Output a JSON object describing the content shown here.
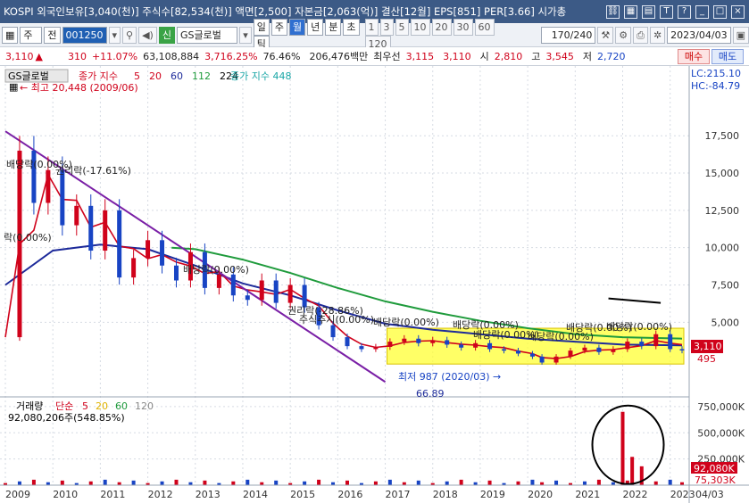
{
  "titlebar": {
    "text": "KOSPI 외국인보유[3,040(천)] 주식수[82,534(천)] 액면[2,500] 자본금[2,063(억)] 결산[12월] EPS[851] PER[3.66] 시가총",
    "icons": [
      "link-icon",
      "grid-icon",
      "tile-icon",
      "text-icon",
      "help-icon",
      "minimize-icon",
      "maximize-icon",
      "close-icon"
    ]
  },
  "toolbar": {
    "type_select": "주",
    "prev_label": "전",
    "code_value": "001250",
    "sound_icon": "speaker-icon",
    "credit_badge": "신",
    "name_value": "GS글로벌",
    "periods": [
      "일",
      "주",
      "월",
      "년",
      "분",
      "초",
      "틱"
    ],
    "selected_period": "월",
    "intervals": [
      "1",
      "3",
      "5",
      "10",
      "20",
      "30",
      "60",
      "120"
    ],
    "count_value": "170/240",
    "date_value": "2023/04/03"
  },
  "quote": {
    "price": "3,110",
    "change": "310",
    "change_pct": "+11.07%",
    "volume": "63,108,884",
    "volume_ratio": "3,716.25%",
    "turnover": "76.46%",
    "amount": "206,476백만",
    "best_label": "최우선",
    "ask": "3,115",
    "bid": "3,110",
    "open_label": "시",
    "open": "2,810",
    "high_label": "고",
    "high": "3,545",
    "low_label": "저",
    "low": "2,720",
    "buy_label": "매수",
    "sell_label": "매도"
  },
  "price_panel": {
    "stock_name": "GS글로벌",
    "ma_label": "종가 지수",
    "ma_periods": [
      "5",
      "20",
      "60",
      "112",
      "224"
    ],
    "ma_colors": [
      "#d0021b",
      "#d0021b",
      "#1d2a9a",
      "#1f9b3c",
      "#000000"
    ],
    "ma448_label": "종가 지수 448",
    "ma448_color": "#19a6a6",
    "lc": "LC:215.10",
    "hc": "HC:-84.79",
    "max_label": "최고 20,448 (2009/06)",
    "min_label": "최저 987 (2020/03)",
    "line_end_label": "66.89",
    "current_price_tag": "3,110",
    "sub_tag": "495",
    "annotations": [
      "배당락(0.00%)",
      "권리락(-17.61%)",
      "락(0.00%)",
      "배당락(0.00%)",
      "권리락(-28.86%)",
      "주식추시(0.00%)",
      "배당락(0.00%)",
      "배당락(0.00%)",
      "배당락(0.00%)",
      "배당락(0.00%)",
      "배당락(0.00%)",
      "배당락(0.00%)"
    ]
  },
  "volume_panel": {
    "label": "거래량",
    "ma_label": "단순",
    "ma_periods": [
      "5",
      "20",
      "60",
      "120"
    ],
    "ma_colors": [
      "#d0021b",
      "#e0b300",
      "#1f9b3c",
      "#888888"
    ],
    "value_text": "92,080,206주(548.85%)",
    "tag_current": "92,080K",
    "tag_sub": "75,303K"
  },
  "xaxis": {
    "years": [
      "2009",
      "2010",
      "2011",
      "2012",
      "2013",
      "2014",
      "2015",
      "2016",
      "2017",
      "2018",
      "2019",
      "2020",
      "2021",
      "2022",
      "2023"
    ],
    "end_label": "04/03"
  },
  "chart_data": {
    "type": "candlestick",
    "title": "",
    "xlabel": "",
    "ylabel": "",
    "price_axis": {
      "ticks": [
        "17,500",
        "15,000",
        "12,500",
        "10,000",
        "7,500",
        "5,000"
      ],
      "tick_values": [
        17500,
        15000,
        12500,
        10000,
        7500,
        5000
      ],
      "ylim": [
        0,
        20500
      ]
    },
    "volume_axis": {
      "ticks": [
        "750,000K",
        "500,000K",
        "250,000K"
      ],
      "tick_values": [
        750000,
        500000,
        250000
      ],
      "unit": "K",
      "ylim": [
        0,
        800000
      ]
    },
    "x_range": [
      2009.0,
      2023.25
    ],
    "series": [
      {
        "name": "Close",
        "color": "#1844c4",
        "x": [
          2009.0,
          2009.3,
          2009.6,
          2009.9,
          2010.2,
          2010.5,
          2010.8,
          2011.1,
          2011.4,
          2011.7,
          2012.0,
          2012.3,
          2012.6,
          2012.9,
          2013.2,
          2013.5,
          2013.8,
          2014.1,
          2014.4,
          2014.7,
          2015.0,
          2015.3,
          2015.6,
          2015.9,
          2016.2,
          2016.5,
          2016.8,
          2017.1,
          2017.4,
          2017.7,
          2018.0,
          2018.3,
          2018.6,
          2018.9,
          2019.2,
          2019.5,
          2019.8,
          2020.1,
          2020.3,
          2020.6,
          2020.9,
          2021.2,
          2021.5,
          2021.8,
          2022.1,
          2022.4,
          2022.7,
          2023.0,
          2023.25
        ],
        "y": [
          4000,
          16500,
          13000,
          15200,
          11500,
          12800,
          9800,
          12500,
          8000,
          9300,
          10500,
          8800,
          7800,
          9700,
          7300,
          8200,
          6800,
          6500,
          7800,
          6300,
          7500,
          6000,
          4800,
          4000,
          3400,
          3200,
          3350,
          3700,
          3900,
          3600,
          3800,
          3500,
          3300,
          3600,
          3200,
          3100,
          2900,
          2700,
          2300,
          2700,
          3100,
          3300,
          3000,
          3200,
          3700,
          3400,
          4200,
          3200,
          3110
        ]
      },
      {
        "name": "60MA",
        "color": "#1d2a9a",
        "x": [
          2009.0,
          2010.0,
          2011.0,
          2012.0,
          2013.0,
          2014.0,
          2015.0,
          2016.0,
          2017.0,
          2018.0,
          2019.0,
          2020.0,
          2021.0,
          2022.0,
          2023.25
        ],
        "y": [
          7500,
          9800,
          10200,
          9900,
          8800,
          7600,
          6800,
          5800,
          4900,
          4500,
          4200,
          3900,
          3700,
          3500,
          3450
        ]
      },
      {
        "name": "112MA",
        "color": "#1f9b3c",
        "x": [
          2012.5,
          2013.0,
          2014.0,
          2015.0,
          2016.0,
          2017.0,
          2018.0,
          2019.0,
          2020.0,
          2021.0,
          2022.0,
          2023.25
        ],
        "y": [
          10000,
          9900,
          9200,
          8300,
          7300,
          6400,
          5700,
          5100,
          4600,
          4200,
          4000,
          3900
        ]
      }
    ],
    "trendlines": [
      {
        "from": [
          2009.0,
          17800
        ],
        "to": [
          2017.0,
          1000
        ]
      },
      {
        "from": [
          2021.7,
          6600
        ],
        "to": [
          2022.8,
          6300
        ]
      }
    ],
    "highlight_box": {
      "x": [
        2017.0,
        2023.25
      ],
      "y": [
        2200,
        4600
      ]
    },
    "volume_spikes": [
      {
        "x": 2022.0,
        "value": 700000
      },
      {
        "x": 2022.2,
        "value": 270000
      },
      {
        "x": 2022.4,
        "value": 180000
      }
    ],
    "max": {
      "x": 2009.4,
      "value": 20448,
      "date": "2009/06"
    },
    "min": {
      "x": 2020.2,
      "value": 987,
      "date": "2020/03"
    }
  }
}
